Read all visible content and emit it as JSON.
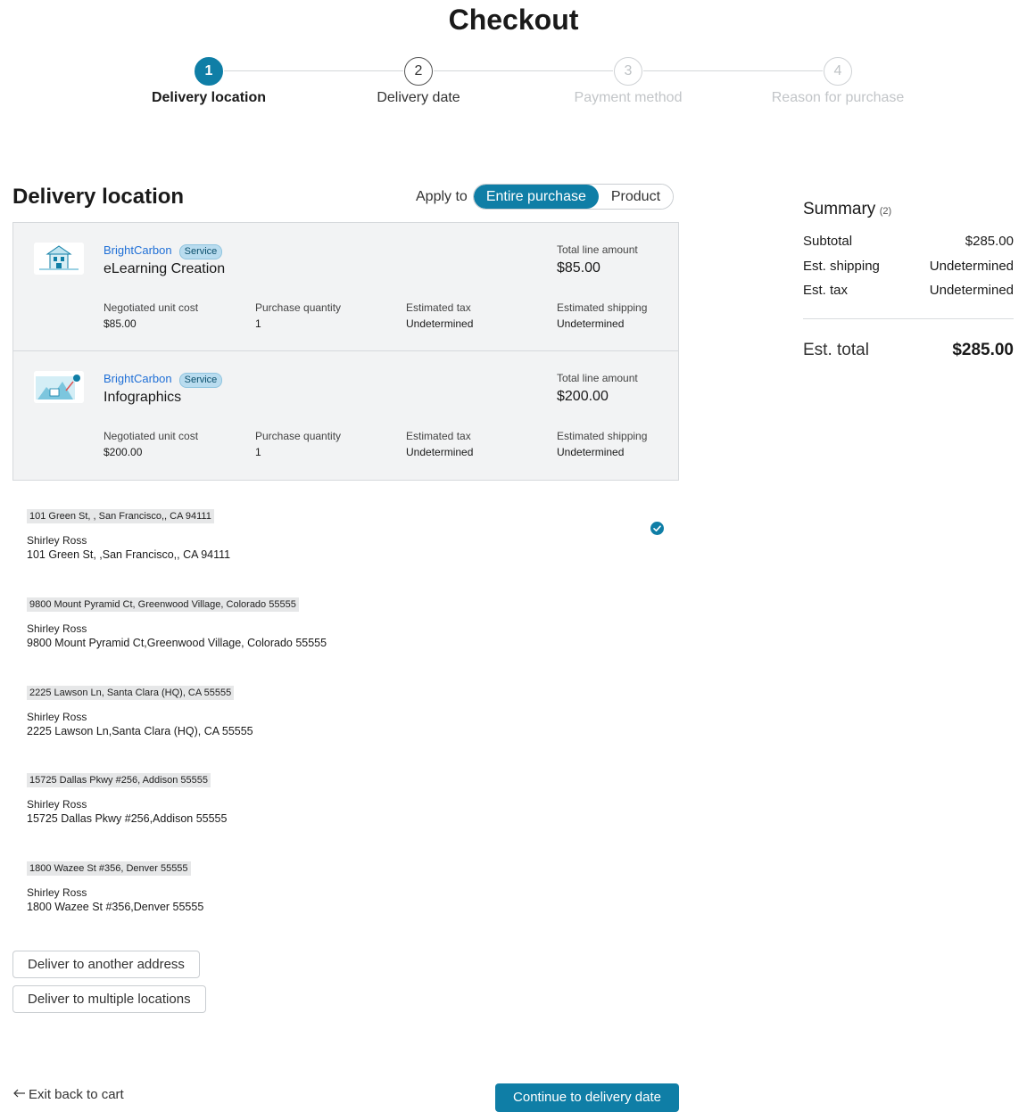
{
  "page": {
    "title": "Checkout"
  },
  "stepper": {
    "steps": [
      {
        "number": "1",
        "label": "Delivery location",
        "state": "active"
      },
      {
        "number": "2",
        "label": "Delivery date",
        "state": "upcoming"
      },
      {
        "number": "3",
        "label": "Payment method",
        "state": "disabled"
      },
      {
        "number": "4",
        "label": "Reason for purchase",
        "state": "disabled"
      }
    ]
  },
  "delivery": {
    "title": "Delivery location",
    "apply_to_label": "Apply to",
    "apply_options": [
      "Entire purchase",
      "Product"
    ],
    "apply_selected": "Entire purchase"
  },
  "products": [
    {
      "vendor": "BrightCarbon",
      "badge": "Service",
      "name": "eLearning Creation",
      "total_label": "Total line amount",
      "total_value": "$85.00",
      "unit_cost_label": "Negotiated unit cost",
      "unit_cost": "$85.00",
      "qty_label": "Purchase quantity",
      "qty": "1",
      "tax_label": "Estimated tax",
      "tax": "Undetermined",
      "shipping_label": "Estimated shipping",
      "shipping": "Undetermined",
      "thumb_icon": "elearning-illustration-icon"
    },
    {
      "vendor": "BrightCarbon",
      "badge": "Service",
      "name": "Infographics",
      "total_label": "Total line amount",
      "total_value": "$200.00",
      "unit_cost_label": "Negotiated unit cost",
      "unit_cost": "$200.00",
      "qty_label": "Purchase quantity",
      "qty": "1",
      "tax_label": "Estimated tax",
      "tax": "Undetermined",
      "shipping_label": "Estimated shipping",
      "shipping": "Undetermined",
      "thumb_icon": "infographic-illustration-icon"
    }
  ],
  "addresses": [
    {
      "tag": "101 Green St, , San Francisco,, CA 94111",
      "name": "Shirley Ross",
      "line": "101 Green St, ,San Francisco,, CA 94111",
      "selected": true
    },
    {
      "tag": "9800 Mount Pyramid Ct, Greenwood Village, Colorado 55555",
      "name": "Shirley Ross",
      "line": "9800 Mount Pyramid Ct,Greenwood Village, Colorado 55555",
      "selected": false
    },
    {
      "tag": "2225 Lawson Ln, Santa Clara (HQ), CA 55555",
      "name": "Shirley Ross",
      "line": "2225 Lawson Ln,Santa Clara (HQ), CA 55555",
      "selected": false
    },
    {
      "tag": "15725 Dallas Pkwy #256, Addison 55555",
      "name": "Shirley Ross",
      "line": "15725 Dallas Pkwy #256,Addison 55555",
      "selected": false
    },
    {
      "tag": "1800 Wazee St #356, Denver 55555",
      "name": "Shirley Ross",
      "line": "1800 Wazee St #356,Denver 55555",
      "selected": false
    }
  ],
  "actions": {
    "deliver_another": "Deliver to another address",
    "deliver_multiple": "Deliver to multiple locations",
    "exit": "Exit back to cart",
    "continue": "Continue to delivery date"
  },
  "summary": {
    "title": "Summary",
    "count": "(2)",
    "rows": [
      {
        "label": "Subtotal",
        "value": "$285.00"
      },
      {
        "label": "Est. shipping",
        "value": "Undetermined"
      },
      {
        "label": "Est. tax",
        "value": "Undetermined"
      }
    ],
    "total_label": "Est. total",
    "total_value": "$285.00"
  },
  "colors": {
    "accent": "#0f7ea6",
    "link": "#1f6fd6",
    "card_bg": "#f2f3f4"
  }
}
